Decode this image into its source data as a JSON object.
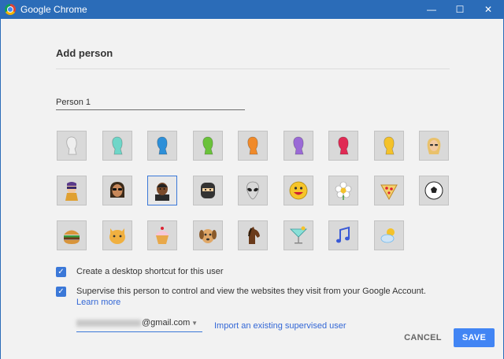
{
  "window": {
    "title": "Google Chrome",
    "minimize_label": "—",
    "maximize_label": "☐",
    "close_label": "✕"
  },
  "dialog": {
    "heading": "Add person",
    "name_value": "Person 1",
    "avatars": [
      {
        "icon": "silhouette-white-icon",
        "color": "#eeeeee"
      },
      {
        "icon": "silhouette-teal-icon",
        "color": "#6fd6c8"
      },
      {
        "icon": "silhouette-blue-icon",
        "color": "#2d8fd8"
      },
      {
        "icon": "silhouette-green-icon",
        "color": "#6ac23a"
      },
      {
        "icon": "silhouette-orange-icon",
        "color": "#f08a2a"
      },
      {
        "icon": "silhouette-purple-icon",
        "color": "#9a6ad6"
      },
      {
        "icon": "silhouette-red-icon",
        "color": "#e02a54"
      },
      {
        "icon": "silhouette-yellow-icon",
        "color": "#f4c22a"
      },
      {
        "icon": "blonde-person-icon",
        "color": "#e9c16b"
      },
      {
        "icon": "hero-icon",
        "color": "#7c6ad6"
      },
      {
        "icon": "sunglasses-person-icon",
        "color": "#7a4a2a"
      },
      {
        "icon": "businessman-icon",
        "color": "#5a3a22"
      },
      {
        "icon": "ninja-icon",
        "color": "#333333"
      },
      {
        "icon": "alien-icon",
        "color": "#cfcfcf"
      },
      {
        "icon": "smiley-icon",
        "color": "#f6c52a"
      },
      {
        "icon": "flower-icon",
        "color": "#ffffff"
      },
      {
        "icon": "pizza-icon",
        "color": "#e8a84a"
      },
      {
        "icon": "soccer-ball-icon",
        "color": "#222222"
      },
      {
        "icon": "burger-icon",
        "color": "#b86a2a"
      },
      {
        "icon": "cat-icon",
        "color": "#f0b040"
      },
      {
        "icon": "cupcake-icon",
        "color": "#e66a8a"
      },
      {
        "icon": "dog-icon",
        "color": "#c8884a"
      },
      {
        "icon": "horse-icon",
        "color": "#6a3a1a"
      },
      {
        "icon": "cocktail-icon",
        "color": "#6ad6c8"
      },
      {
        "icon": "music-note-icon",
        "color": "#3a5ad6"
      },
      {
        "icon": "weather-icon",
        "color": "#6ab8f0"
      }
    ],
    "selected_avatar_index": 11,
    "desktop_shortcut_label": "Create a desktop shortcut for this user",
    "supervise_label": "Supervise this person to control and view the websites they visit from your Google Account.",
    "learn_more_label": "Learn more",
    "account_suffix": "@gmail.com",
    "import_link_label": "Import an existing supervised user",
    "cancel_label": "CANCEL",
    "save_label": "SAVE",
    "accent_color": "#4285f4"
  }
}
